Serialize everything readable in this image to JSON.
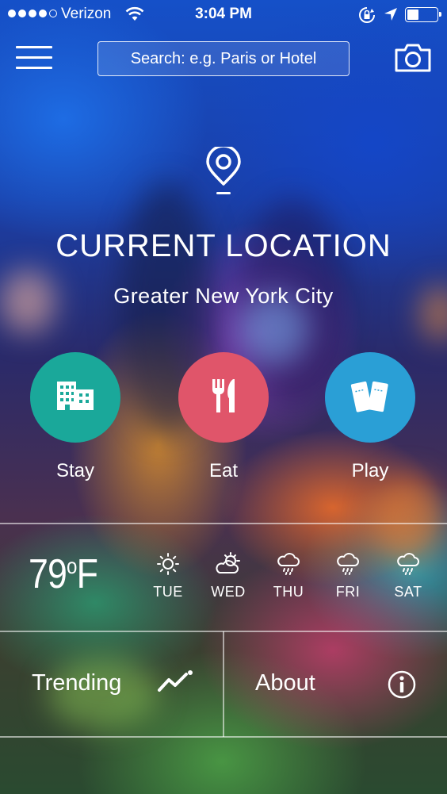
{
  "status_bar": {
    "carrier": "Verizon",
    "time": "3:04 PM",
    "signal_bars": 4,
    "signal_total": 5,
    "battery_level": 0.4
  },
  "header": {
    "menu_icon": "hamburger-menu-icon",
    "search_placeholder": "Search: e.g. Paris or Hotel",
    "camera_icon": "camera-icon"
  },
  "location": {
    "title": "CURRENT LOCATION",
    "subtitle": "Greater New York City",
    "icon": "location-pin-icon"
  },
  "categories": [
    {
      "label": "Stay",
      "icon": "hotel-building-icon",
      "color": "#1aa89a"
    },
    {
      "label": "Eat",
      "icon": "fork-knife-icon",
      "color": "#e0556a"
    },
    {
      "label": "Play",
      "icon": "tickets-icon",
      "color": "#2a9fd6"
    }
  ],
  "weather": {
    "temperature": "79",
    "unit": "°F",
    "days": [
      {
        "label": "TUE",
        "icon": "sunny-icon"
      },
      {
        "label": "WED",
        "icon": "partly-cloudy-icon"
      },
      {
        "label": "THU",
        "icon": "rain-cloud-icon"
      },
      {
        "label": "FRI",
        "icon": "rain-cloud-icon"
      },
      {
        "label": "SAT",
        "icon": "rain-cloud-icon"
      }
    ]
  },
  "footer": {
    "trending_label": "Trending",
    "trending_icon": "trend-line-icon",
    "about_label": "About",
    "about_icon": "info-circle-icon"
  }
}
